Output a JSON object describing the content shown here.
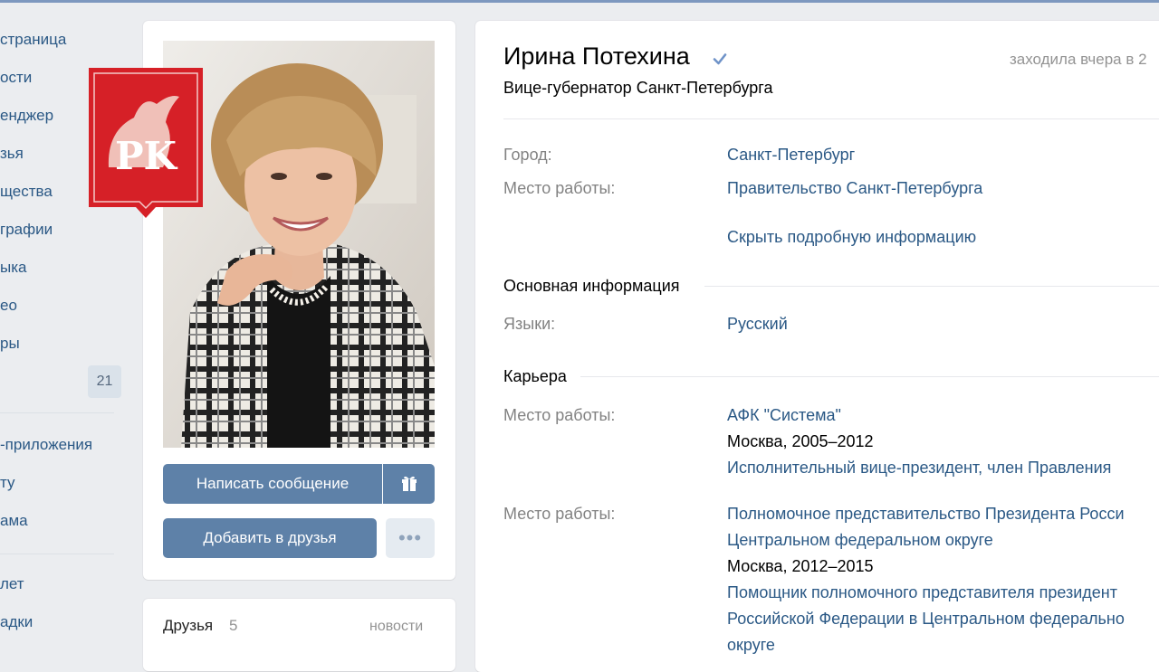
{
  "nav": {
    "items": [
      {
        "label": "страница"
      },
      {
        "label": "ости"
      },
      {
        "label": "енджер"
      },
      {
        "label": "зья"
      },
      {
        "label": "щества"
      },
      {
        "label": "графии"
      },
      {
        "label": "ыка"
      },
      {
        "label": "ео"
      },
      {
        "label": "ры"
      },
      {
        "label": ""
      },
      {
        "label": "-приложения"
      },
      {
        "label": "ту"
      },
      {
        "label": "ама"
      },
      {
        "label": "лет"
      },
      {
        "label": "адки"
      }
    ],
    "badge": "21"
  },
  "logo": {
    "text": "PK"
  },
  "profile": {
    "buttons": {
      "message": "Написать сообщение",
      "add_friend": "Добавить в друзья",
      "more": "•••"
    },
    "friends": {
      "title": "Друзья",
      "count": "5",
      "link": "новости"
    }
  },
  "info": {
    "name": "Ирина Потехина",
    "status": "Вице-губернатор Санкт-Петербурга",
    "last_seen": "заходила вчера в 2",
    "city_label": "Город:",
    "city": "Санкт-Петербург",
    "work_label": "Место работы:",
    "work": "Правительство Санкт-Петербурга",
    "hide_details": "Скрыть подробную информацию",
    "main_section": "Основная информация",
    "languages_label": "Языки:",
    "languages": "Русский",
    "career_section": "Карьера",
    "career": [
      {
        "label": "Место работы:",
        "company": "АФК \"Система\"",
        "period": "Москва, 2005–2012",
        "position": "Исполнительный вице-президент, член Правления"
      },
      {
        "label": "Место работы:",
        "company_line1": "Полномочное представительство Президента Росси",
        "company_line2": "Центральном федеральном округе",
        "period": "Москва, 2012–2015",
        "position_line1": "Помощник полномочного представителя президент",
        "position_line2": "Российской Федерации в Центральном федерально",
        "position_line3": "округе"
      }
    ]
  },
  "colors": {
    "link": "#2a5885",
    "button": "#5e81a8",
    "background": "#ebedf0",
    "logo": "#d62027"
  }
}
